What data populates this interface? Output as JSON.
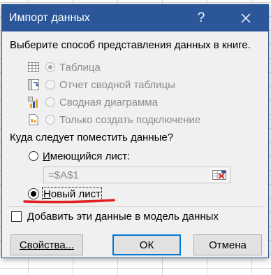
{
  "window": {
    "title": "Импорт данных",
    "help_glyph": "?"
  },
  "section_view": {
    "prompt": "Выберите способ представления данных в книге.",
    "options": [
      {
        "label": "Таблица",
        "icon": "table-icon",
        "selected": true,
        "enabled": false
      },
      {
        "label": "Отчет сводной таблицы",
        "icon": "pivot-table-icon",
        "selected": false,
        "enabled": false
      },
      {
        "label": "Сводная диаграмма",
        "icon": "pivot-chart-icon",
        "selected": false,
        "enabled": false
      },
      {
        "label": "Только создать подключение",
        "icon": "connection-icon",
        "selected": false,
        "enabled": false
      }
    ]
  },
  "section_location": {
    "prompt": "Куда следует поместить данные?",
    "existing_sheet": {
      "label": "Имеющийся лист:",
      "selected": false
    },
    "reference_value": "=$A$1",
    "new_sheet": {
      "label": "Новый лист",
      "selected": true
    }
  },
  "data_model": {
    "label": "Добавить эти данные в модель данных",
    "checked": false
  },
  "buttons": {
    "properties": "Свойства...",
    "ok": "ОК",
    "cancel": "Отмена"
  },
  "colors": {
    "titlebar": "#2b579a",
    "annotation": "#e02020",
    "focus": "#0078d7"
  }
}
